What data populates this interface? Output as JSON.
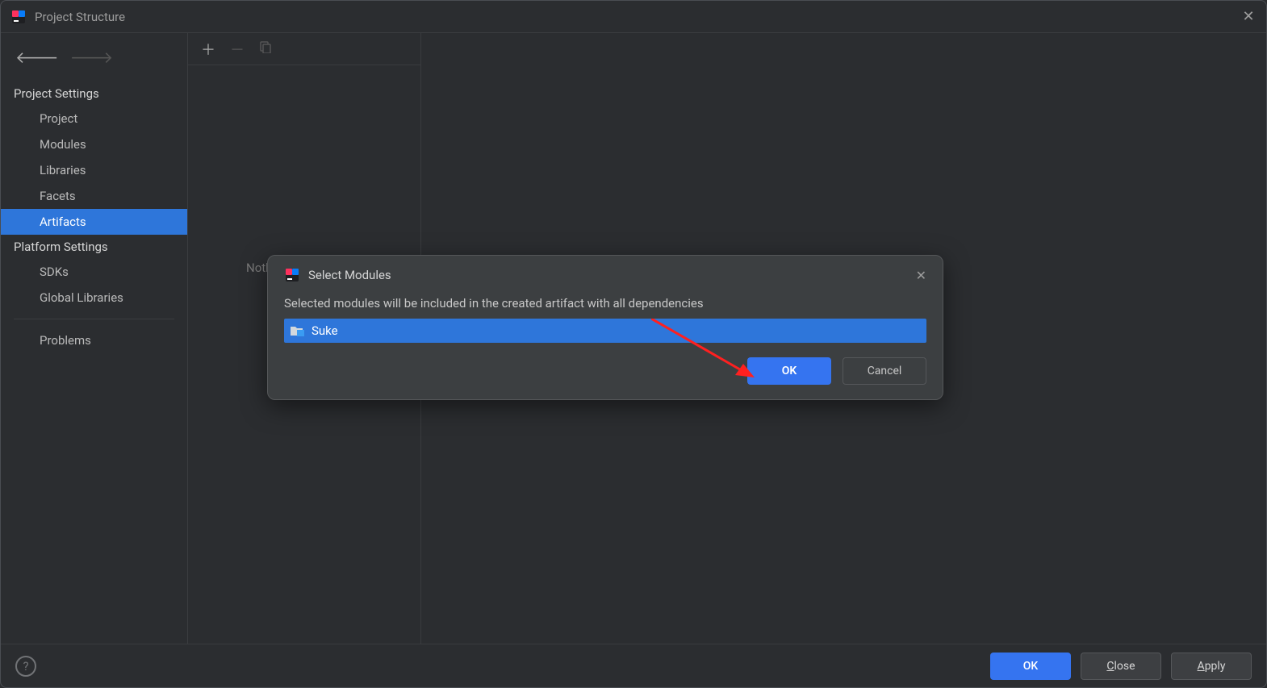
{
  "window": {
    "title": "Project Structure"
  },
  "sidebar": {
    "sections": {
      "project_settings": {
        "header": "Project Settings",
        "items": [
          "Project",
          "Modules",
          "Libraries",
          "Facets",
          "Artifacts"
        ]
      },
      "platform_settings": {
        "header": "Platform Settings",
        "items": [
          "SDKs",
          "Global Libraries"
        ]
      },
      "problems": "Problems"
    }
  },
  "content": {
    "nothing": "Nothing to show"
  },
  "modal": {
    "title": "Select Modules",
    "description": "Selected modules will be included in the created artifact with all dependencies",
    "module_name": "Suke",
    "ok": "OK",
    "cancel": "Cancel"
  },
  "bottom": {
    "ok": "OK",
    "close": "Close",
    "apply": "Apply"
  }
}
